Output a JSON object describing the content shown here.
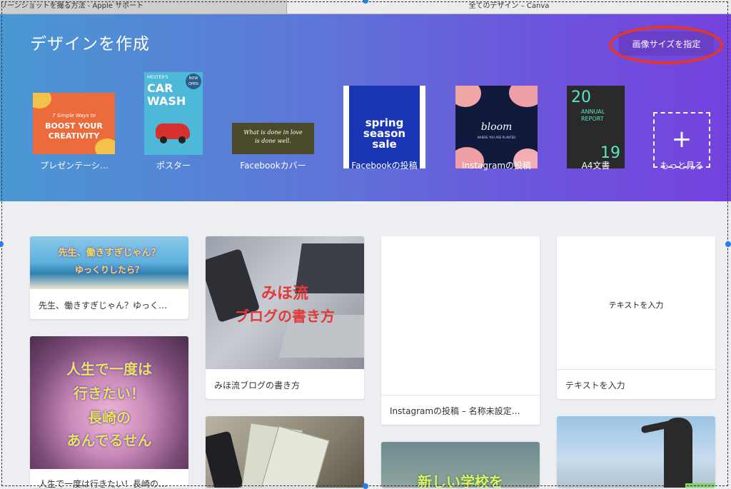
{
  "browser": {
    "tab_left": "リーンショットを撮る方法 - Apple サポート",
    "tab_right": "全てのデザイン – Canva"
  },
  "header": {
    "title": "デザインを作成",
    "custom_size_button": "画像サイズを指定"
  },
  "templates": [
    {
      "label": "プレゼンテーシ…",
      "thumb_lines": [
        "7 Simple Ways to",
        "BOOST YOUR",
        "CREATIVITY"
      ]
    },
    {
      "label": "ポスター",
      "thumb_lines": [
        "MESTER'S",
        "CAR",
        "WASH",
        "NOW",
        "OPEN"
      ]
    },
    {
      "label": "Facebookカバー",
      "thumb_lines": [
        "What is done in love",
        "is done well."
      ]
    },
    {
      "label": "Facebookの投稿",
      "thumb_lines": [
        "spring",
        "season",
        "sale"
      ]
    },
    {
      "label": "Instagramの投稿",
      "thumb_lines": [
        "bloom",
        "WHERE YOU ARE PLANTED"
      ]
    },
    {
      "label": "A4文書",
      "thumb_lines": [
        "20",
        "ANNUAL",
        "REPORT",
        "19"
      ]
    },
    {
      "label": "もっと見る",
      "thumb_lines": [
        "+"
      ]
    }
  ],
  "designs": [
    {
      "title": "先生、働きすぎじゃん？ゆっく…",
      "overlay": [
        "先生、働きすぎじゃん？",
        "ゆっくりしたら？"
      ]
    },
    {
      "title": "みほ流ブログの書き方",
      "overlay": [
        "みほ流",
        "ブログの書き方"
      ]
    },
    {
      "title": "Instagramの投稿 – 名称未設定…",
      "overlay": []
    },
    {
      "title": "テキストを入力",
      "overlay": [
        "テキストを入力"
      ]
    },
    {
      "title": "人生で一度は行きたい！長崎の…",
      "overlay": [
        "人生で一度は",
        "行きたい！",
        "長崎の",
        "あんでるせん"
      ]
    },
    {
      "title": "",
      "overlay": []
    },
    {
      "title": "",
      "overlay": [
        "新しい学校を"
      ]
    },
    {
      "title": "",
      "overlay": []
    }
  ],
  "colors": {
    "accent_button": "#6a3fc7",
    "highlight_ring": "#e5362a",
    "gradient_start": "#4a98d3",
    "gradient_end": "#7542df"
  }
}
